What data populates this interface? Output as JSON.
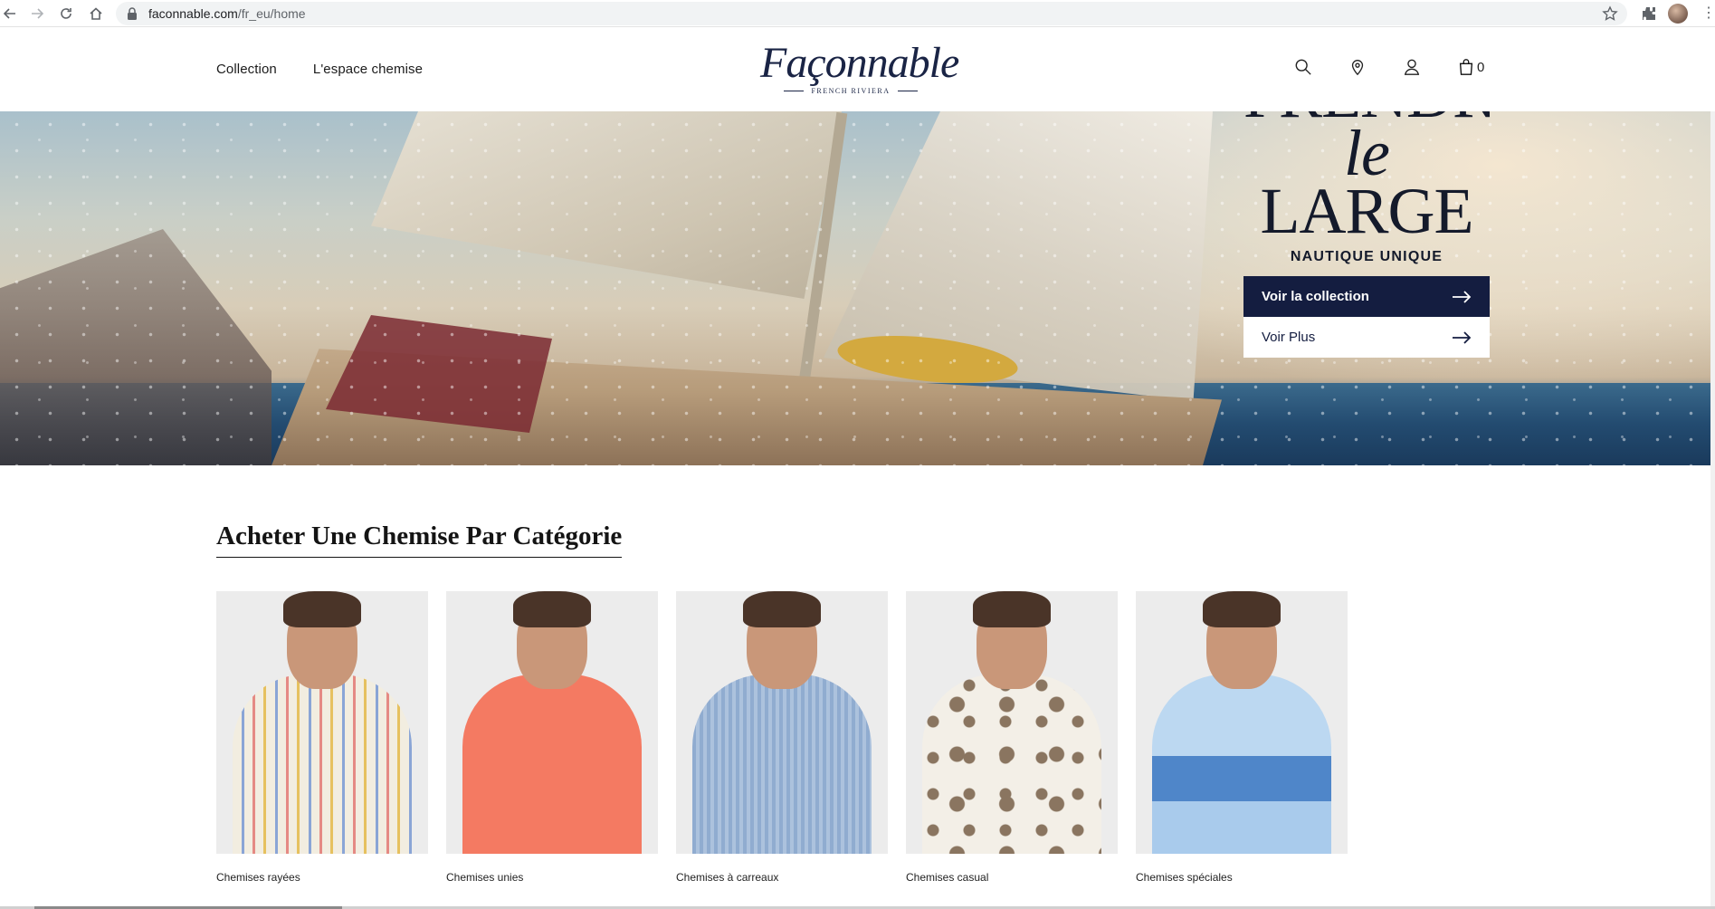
{
  "browser": {
    "url_host": "faconnable.com",
    "url_path": "/fr_eu/home"
  },
  "header": {
    "nav": [
      "Collection",
      "L'espace chemise"
    ],
    "logo_wordmark": "Façonnable",
    "logo_tagline": "FRENCH RIVIERA",
    "cart_count": "0",
    "icons": [
      "search-icon",
      "store-locator-icon",
      "account-icon",
      "bag-icon"
    ]
  },
  "hero": {
    "headline_top": "PRENDRE",
    "headline_italic": "le",
    "headline_main": "LARGE",
    "subtitle": "NAUTIQUE UNIQUE",
    "primary_button": "Voir la collection",
    "secondary_button": "Voir Plus"
  },
  "categories": {
    "title": "Acheter Une Chemise Par Catégorie",
    "items": [
      {
        "label": "Chemises rayées"
      },
      {
        "label": "Chemises unies"
      },
      {
        "label": "Chemises à carreaux"
      },
      {
        "label": "Chemises casual"
      },
      {
        "label": "Chemises spéciales"
      }
    ]
  },
  "colors": {
    "brand_navy": "#141d40",
    "logo_navy": "#1a2445"
  }
}
